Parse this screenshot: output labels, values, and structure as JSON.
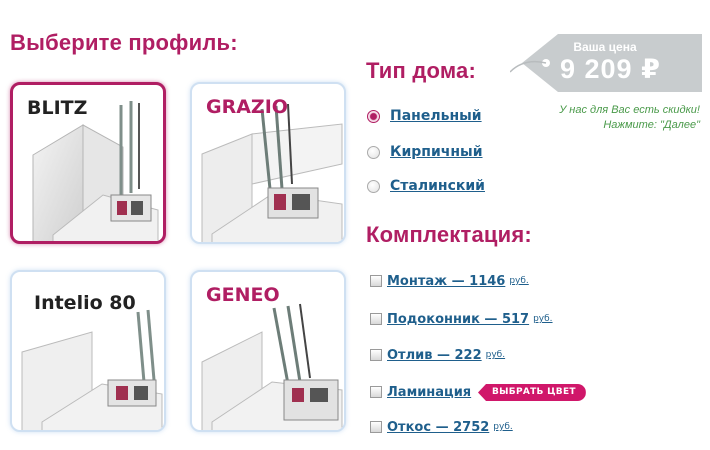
{
  "profile_heading": "Выберите профиль:",
  "profiles": [
    {
      "name": "BLITZ",
      "selected": true
    },
    {
      "name": "GRAZIO",
      "selected": false
    },
    {
      "name": "Intelio 80",
      "selected": false
    },
    {
      "name": "GENEO",
      "selected": false
    }
  ],
  "price": {
    "label": "Ваша цена",
    "value": "9 209 ₽"
  },
  "discount": {
    "line1": "У нас для Вас есть скидки!",
    "line2": "Нажмите: \"Далее\""
  },
  "house_type": {
    "heading": "Тип дома:",
    "options": [
      {
        "label": "Панельный",
        "checked": true
      },
      {
        "label": "Кирпичный",
        "checked": false
      },
      {
        "label": "Сталинский",
        "checked": false
      }
    ]
  },
  "equipment": {
    "heading": "Комплектация:",
    "items": [
      {
        "label": "Монтаж — 1146",
        "unit": "руб."
      },
      {
        "label": "Подоконник — 517",
        "unit": "руб."
      },
      {
        "label": "Отлив — 222",
        "unit": "руб."
      },
      {
        "label": "Ламинация",
        "unit": ""
      },
      {
        "label": "Откос — 2752",
        "unit": "руб."
      }
    ],
    "color_button": "ВЫБРАТЬ ЦВЕТ"
  },
  "colors": {
    "accent": "#b01e63",
    "link": "#1f5f8c",
    "discount_text": "#4a9a4a",
    "price_tag": "#c8ccce"
  }
}
